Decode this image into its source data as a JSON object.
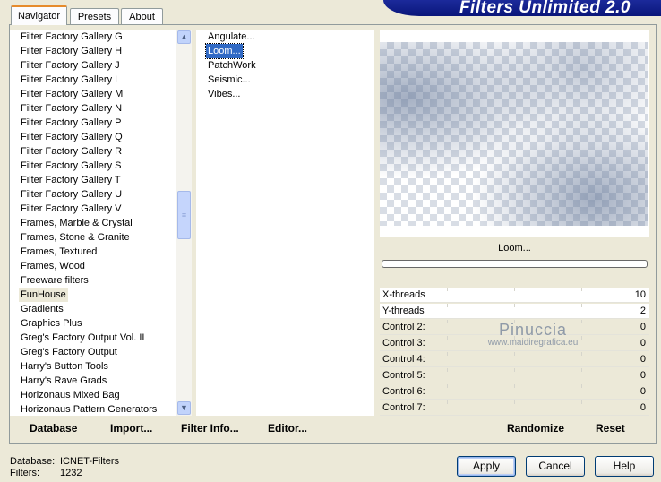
{
  "banner": {
    "title": "Filters Unlimited 2.0"
  },
  "tabs": [
    {
      "label": "Navigator",
      "active": true
    },
    {
      "label": "Presets",
      "active": false
    },
    {
      "label": "About",
      "active": false
    }
  ],
  "categories": {
    "items": [
      "Filter Factory Gallery G",
      "Filter Factory Gallery H",
      "Filter Factory Gallery J",
      "Filter Factory Gallery L",
      "Filter Factory Gallery M",
      "Filter Factory Gallery N",
      "Filter Factory Gallery P",
      "Filter Factory Gallery Q",
      "Filter Factory Gallery R",
      "Filter Factory Gallery S",
      "Filter Factory Gallery T",
      "Filter Factory Gallery U",
      "Filter Factory Gallery V",
      "Frames, Marble & Crystal",
      "Frames, Stone & Granite",
      "Frames, Textured",
      "Frames, Wood",
      "Freeware filters",
      "FunHouse",
      "Gradients",
      "Graphics Plus",
      "Greg's Factory Output Vol. II",
      "Greg's Factory Output",
      "Harry's Button Tools",
      "Harry's Rave Grads",
      "Horizonaus Mixed Bag",
      "Horizonaus Pattern Generators"
    ],
    "selected": "FunHouse"
  },
  "filters": {
    "items": [
      "Angulate...",
      "Loom...",
      "PatchWork",
      "Seismic...",
      "Vibes..."
    ],
    "selected": "Loom..."
  },
  "bottom_links": {
    "database": "Database",
    "import": "Import...",
    "filter_info": "Filter Info...",
    "editor": "Editor..."
  },
  "preview": {
    "filter_name": "Loom..."
  },
  "controls": [
    {
      "label": "X-threads",
      "value": "10"
    },
    {
      "label": "Y-threads",
      "value": "2"
    },
    {
      "label": "Control 2:",
      "value": "0"
    },
    {
      "label": "Control 3:",
      "value": "0"
    },
    {
      "label": "Control 4:",
      "value": "0"
    },
    {
      "label": "Control 5:",
      "value": "0"
    },
    {
      "label": "Control 6:",
      "value": "0"
    },
    {
      "label": "Control 7:",
      "value": "0"
    }
  ],
  "watermark": {
    "name": "Pinuccia",
    "url": "www.maidiregrafica.eu"
  },
  "actions": {
    "randomize": "Randomize",
    "reset": "Reset"
  },
  "footer": {
    "database_label": "Database:",
    "database_value": "ICNET-Filters",
    "filters_label": "Filters:",
    "filters_value": "1232"
  },
  "dialog_buttons": {
    "apply": "Apply",
    "cancel": "Cancel",
    "help": "Help"
  }
}
